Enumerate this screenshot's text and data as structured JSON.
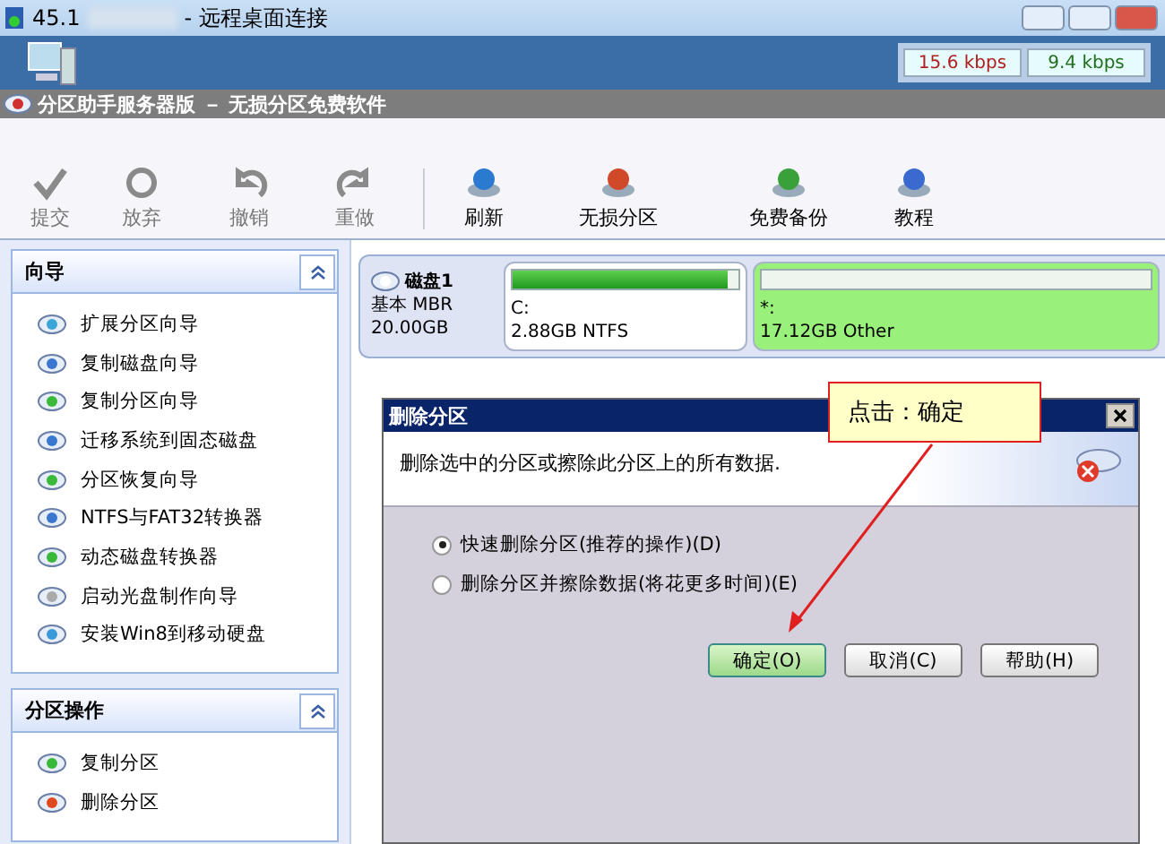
{
  "window": {
    "title_prefix": "45.1",
    "title": "- 远程桌面连接"
  },
  "connection": {
    "upload": "15.6 kbps",
    "download": "9.4 kbps"
  },
  "app": {
    "title": "分区助手服务器版 － 无损分区免费软件"
  },
  "toolbar": [
    {
      "label": "提交",
      "disabled": true
    },
    {
      "label": "放弃",
      "disabled": true
    },
    {
      "label": "撤销",
      "disabled": true
    },
    {
      "label": "重做",
      "disabled": true
    },
    {
      "label": "刷新",
      "disabled": false
    },
    {
      "label": "无损分区",
      "disabled": false
    },
    {
      "label": "免费备份",
      "disabled": false
    },
    {
      "label": "教程",
      "disabled": false
    }
  ],
  "sidebar": [
    {
      "title": "向导",
      "expanded": true,
      "items": [
        "扩展分区向导",
        "复制磁盘向导",
        "复制分区向导",
        "迁移系统到固态磁盘",
        "分区恢复向导",
        "NTFS与FAT32转换器",
        "动态磁盘转换器",
        "启动光盘制作向导",
        "安装Win8到移动硬盘"
      ]
    },
    {
      "title": "分区操作",
      "expanded": true,
      "items": [
        "复制分区",
        "删除分区"
      ]
    }
  ],
  "disk": {
    "name": "磁盘1",
    "type": "基本 MBR",
    "size": "20.00GB",
    "partitions": [
      {
        "label": "C:",
        "info": "2.88GB NTFS",
        "level": 0.95,
        "selected": false
      },
      {
        "label": "*:",
        "info": "17.12GB Other",
        "selected": true
      }
    ]
  },
  "dialog": {
    "title": "删除分区",
    "message": "删除选中的分区或擦除此分区上的所有数据.",
    "options": [
      {
        "label": "快速删除分区(推荐的操作)(D)",
        "selected": true
      },
      {
        "label": "删除分区并擦除数据(将花更多时间)(E)",
        "selected": false
      }
    ],
    "buttons": [
      {
        "label": "确定(O)",
        "selected": true
      },
      {
        "label": "取消(C)",
        "selected": false
      },
      {
        "label": "帮助(H)",
        "selected": false
      }
    ]
  },
  "callout": {
    "text": "点击：确定"
  }
}
